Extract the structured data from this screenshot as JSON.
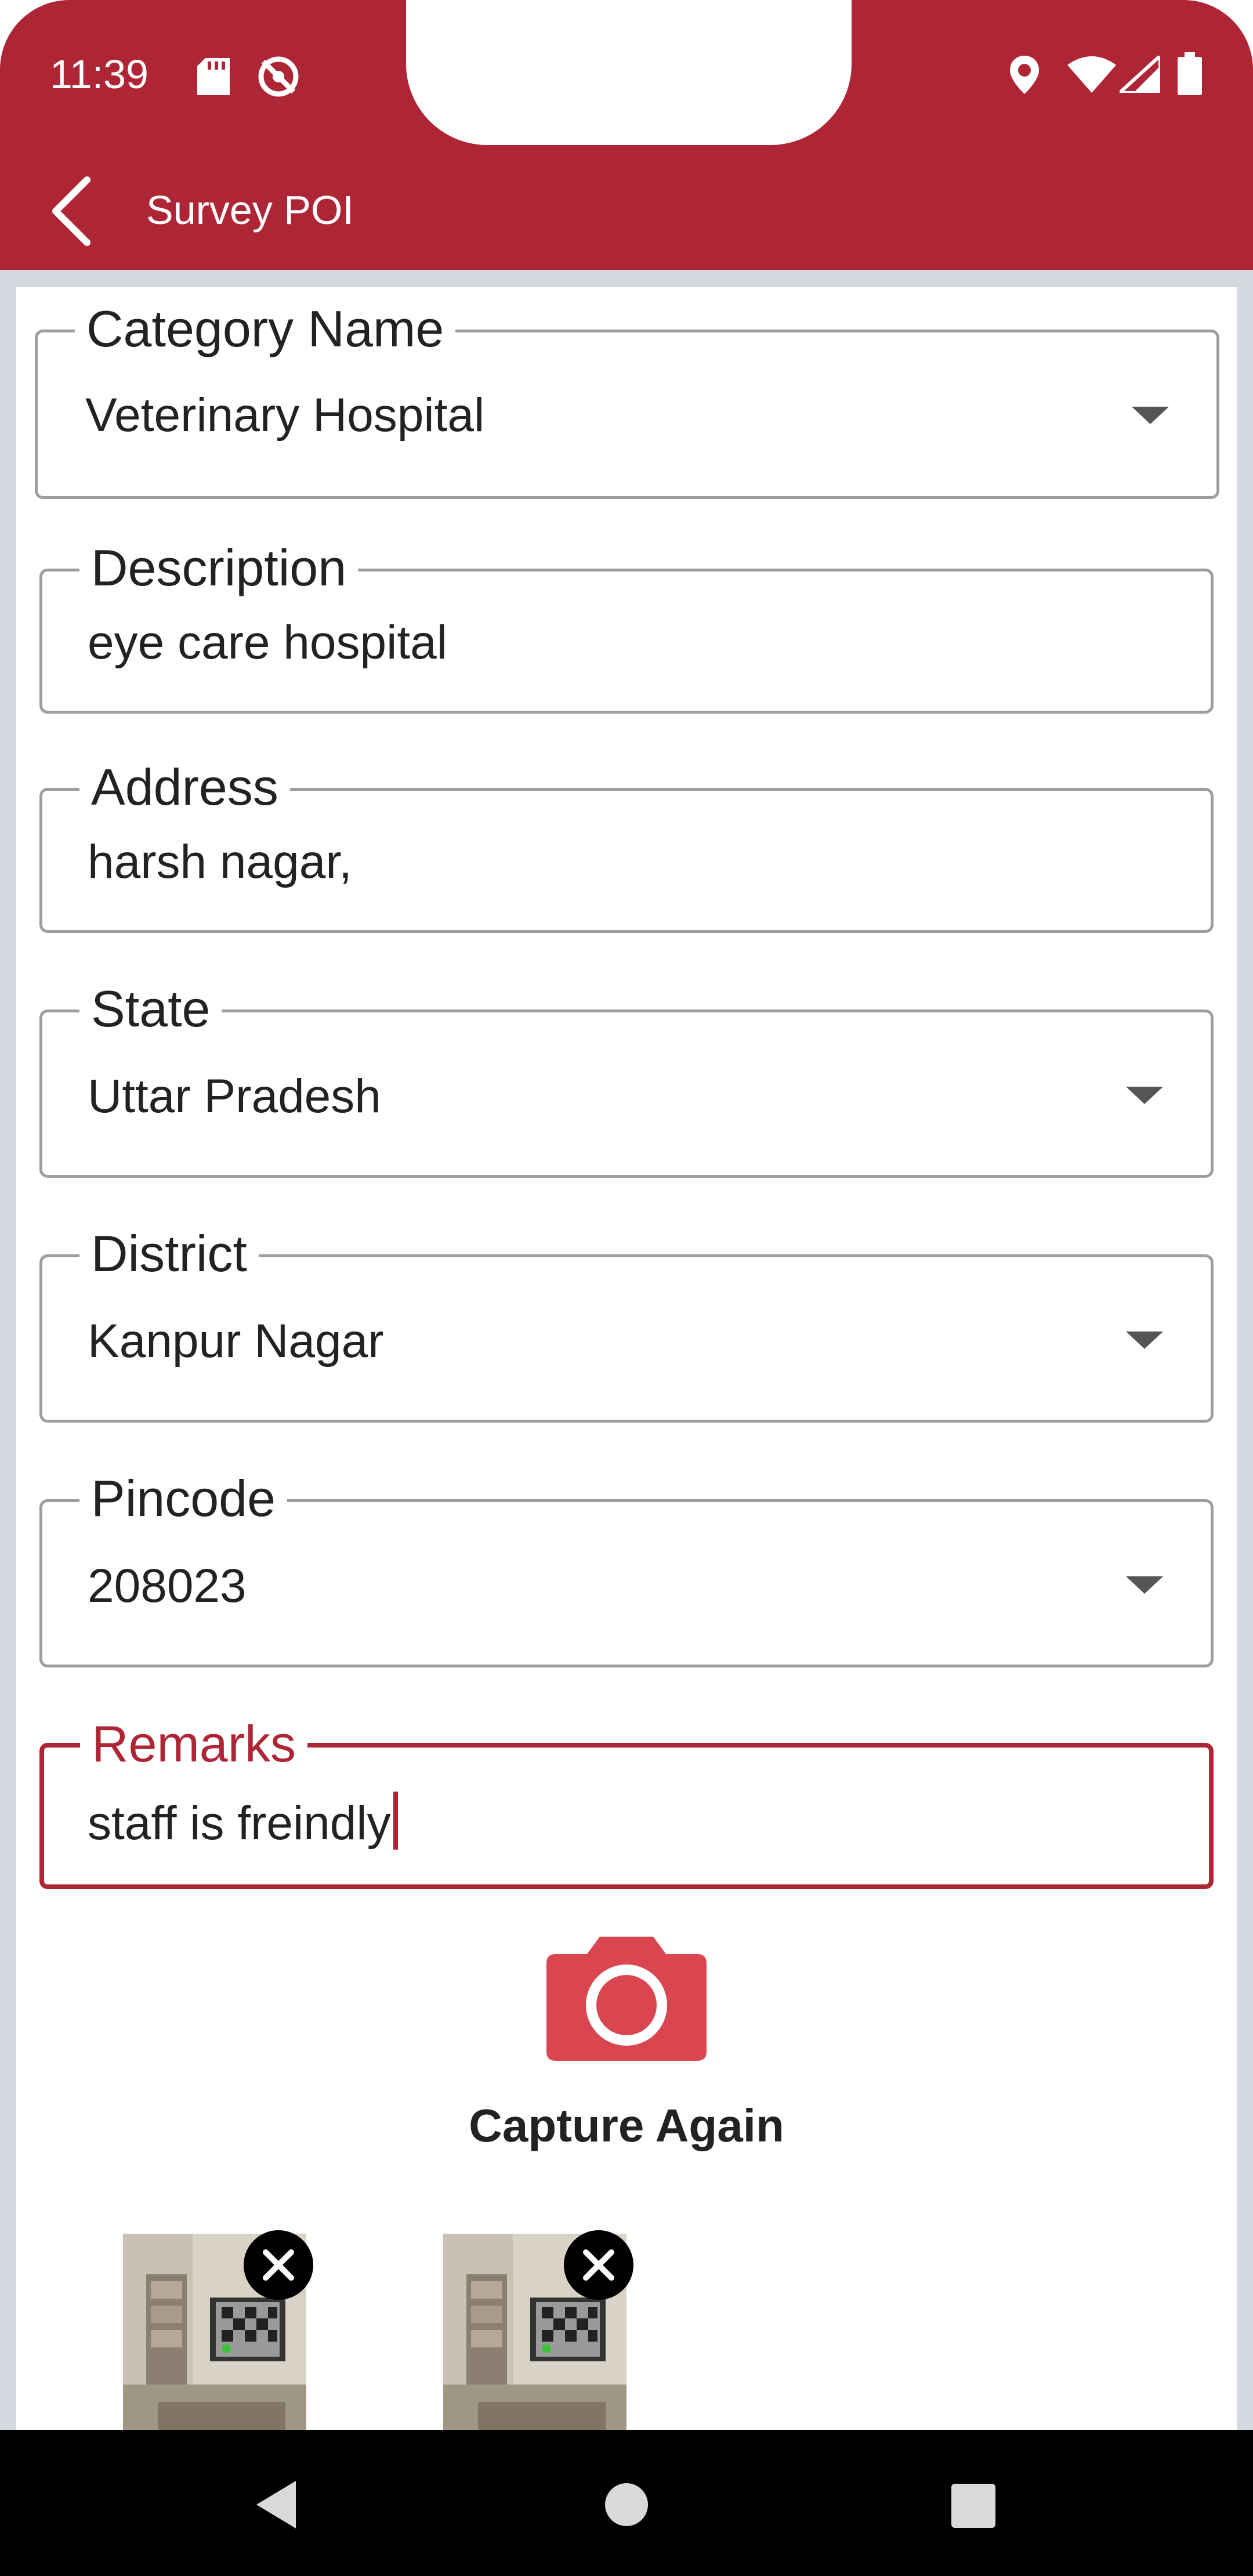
{
  "status_bar": {
    "time": "11:39"
  },
  "app_bar": {
    "title": "Survey POI"
  },
  "form": {
    "category": {
      "label": "Category Name",
      "value": "Veterinary Hospital"
    },
    "description": {
      "label": "Description",
      "value": "eye care hospital"
    },
    "address": {
      "label": "Address",
      "value": "harsh nagar,"
    },
    "state": {
      "label": "State",
      "value": "Uttar Pradesh"
    },
    "district": {
      "label": "District",
      "value": "Kanpur Nagar"
    },
    "pincode": {
      "label": "Pincode",
      "value": "208023"
    },
    "remarks": {
      "label": "Remarks",
      "value": "staff is freindly"
    }
  },
  "capture": {
    "label": "Capture Again"
  },
  "photos": [
    {
      "icon": "remove-photo-icon"
    },
    {
      "icon": "remove-photo-icon"
    }
  ],
  "colors": {
    "primary": "#ae2535",
    "camera": "#d9464f",
    "background": "#d4d9df",
    "outline": "#9e9e9e"
  }
}
